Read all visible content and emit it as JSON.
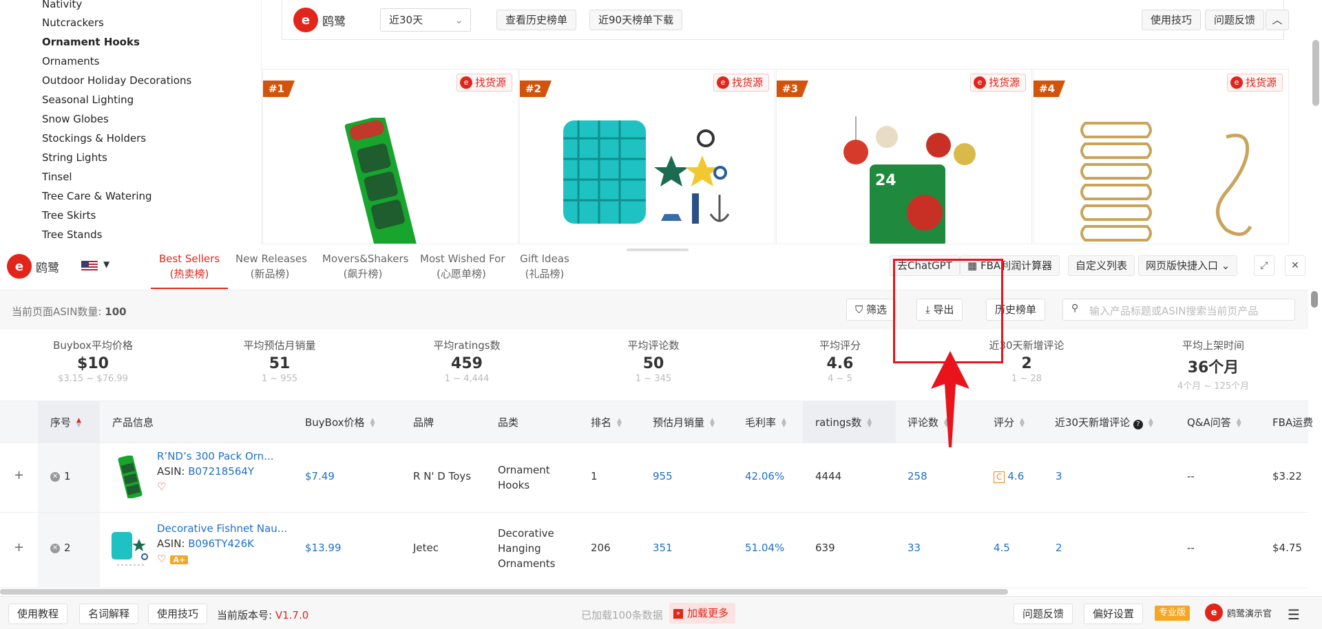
{
  "sidebar": {
    "categories": [
      {
        "label": "Nativity",
        "bold": false
      },
      {
        "label": "Nutcrackers",
        "bold": false
      },
      {
        "label": "Ornament Hooks",
        "bold": true
      },
      {
        "label": "Ornaments",
        "bold": false
      },
      {
        "label": "Outdoor Holiday Decorations",
        "bold": false
      },
      {
        "label": "Seasonal Lighting",
        "bold": false
      },
      {
        "label": "Snow Globes",
        "bold": false
      },
      {
        "label": "Stockings & Holders",
        "bold": false
      },
      {
        "label": "String Lights",
        "bold": false
      },
      {
        "label": "Tinsel",
        "bold": false
      },
      {
        "label": "Tree Care & Watering",
        "bold": false
      },
      {
        "label": "Tree Skirts",
        "bold": false
      },
      {
        "label": "Tree Stands",
        "bold": false
      }
    ]
  },
  "topbar": {
    "logo_text": "鸥鹭",
    "period_select": "近30天",
    "history_btn": "查看历史榜单",
    "download_btn": "近90天榜单下载",
    "tips_btn": "使用技巧",
    "feedback_btn": "问题反馈",
    "collapse_icon": "chevron-up-icon"
  },
  "cards": [
    {
      "rank": "#1",
      "source": "找货源"
    },
    {
      "rank": "#2",
      "source": "找货源"
    },
    {
      "rank": "#3",
      "source": "找货源"
    },
    {
      "rank": "#4",
      "source": "找货源"
    }
  ],
  "panel": {
    "logo_text": "鸥鹭",
    "tabs": [
      {
        "en": "Best Sellers",
        "cn": "(热卖榜)",
        "active": true
      },
      {
        "en": "New Releases",
        "cn": "(新品榜)",
        "active": false
      },
      {
        "en": "Movers&Shakers",
        "cn": "(飙升榜)",
        "active": false
      },
      {
        "en": "Most Wished For",
        "cn": "(心愿单榜)",
        "active": false
      },
      {
        "en": "Gift Ideas",
        "cn": "(礼品榜)",
        "active": false
      }
    ],
    "chatgpt_btn": "去ChatGPT",
    "fba_btn": "FBA利润计算器",
    "custom_cols_btn": "自定义列表",
    "web_entry_btn": "网页版快捷入口"
  },
  "toolbar2": {
    "asin_label": "当前页面ASIN数量:",
    "asin_count": "100",
    "filter_btn": "筛选",
    "export_btn": "导出",
    "history_btn": "历史榜单",
    "search_placeholder": "输入产品标题或ASIN搜索当前页产品"
  },
  "stats": [
    {
      "label": "Buybox平均价格",
      "value": "$10",
      "range": "$3.15 ~ $76.99"
    },
    {
      "label": "平均预估月销量",
      "value": "51",
      "range": "1 ~ 955"
    },
    {
      "label": "平均ratings数",
      "value": "459",
      "range": "1 ~ 4,444"
    },
    {
      "label": "平均评论数",
      "value": "50",
      "range": "1 ~ 345"
    },
    {
      "label": "平均评分",
      "value": "4.6",
      "range": "4 ~ 5"
    },
    {
      "label": "近30天新增评论",
      "value": "2",
      "range": "1 ~ 28"
    },
    {
      "label": "平均上架时间",
      "value": "36个月",
      "range": "4个月 ~ 125个月"
    }
  ],
  "table": {
    "headers": [
      "序号",
      "产品信息",
      "BuyBox价格",
      "品牌",
      "品类",
      "排名",
      "预估月销量",
      "毛利率",
      "ratings数",
      "评论数",
      "评分",
      "近30天新增评论",
      "Q&A问答",
      "FBA运费"
    ],
    "rows": [
      {
        "index": "1",
        "title": "R’ND’s 300 Pack Orn...",
        "asin_label": "ASIN:",
        "asin": "B07218564Y",
        "price": "$7.49",
        "brand": "R N' D Toys",
        "category": [
          "Ornament",
          "Hooks"
        ],
        "rank": "1",
        "sales": "955",
        "margin": "42.06%",
        "ratings": "4444",
        "reviews": "258",
        "grade": "C",
        "rating": "4.6",
        "new_reviews": "3",
        "qa": "--",
        "fba": "$3.22",
        "aplus": ""
      },
      {
        "index": "2",
        "title": "Decorative Fishnet Nau...",
        "asin_label": "ASIN:",
        "asin": "B096TY426K",
        "price": "$13.99",
        "brand": "Jetec",
        "category": [
          "Decorative",
          "Hanging",
          "Ornaments"
        ],
        "rank": "206",
        "sales": "351",
        "margin": "51.04%",
        "ratings": "639",
        "reviews": "33",
        "grade": "",
        "rating": "4.5",
        "new_reviews": "2",
        "qa": "--",
        "fba": "$4.75",
        "aplus": "A+"
      }
    ]
  },
  "footer": {
    "tutorial_btn": "使用教程",
    "glossary_btn": "名词解释",
    "tips_btn": "使用技巧",
    "version_label": "当前版本号:",
    "version": "V1.7.0",
    "loaded_text": "已加载100条数据",
    "load_more": "加载更多",
    "feedback_btn": "问题反馈",
    "prefs_btn": "偏好设置",
    "pro_badge": "专业版",
    "user_name": "鸥鹭演示官"
  },
  "colors": {
    "brand": "#e1251b",
    "link": "#1e6fc9",
    "rank_tag": "#d4530b",
    "annotation": "#e8131b"
  }
}
